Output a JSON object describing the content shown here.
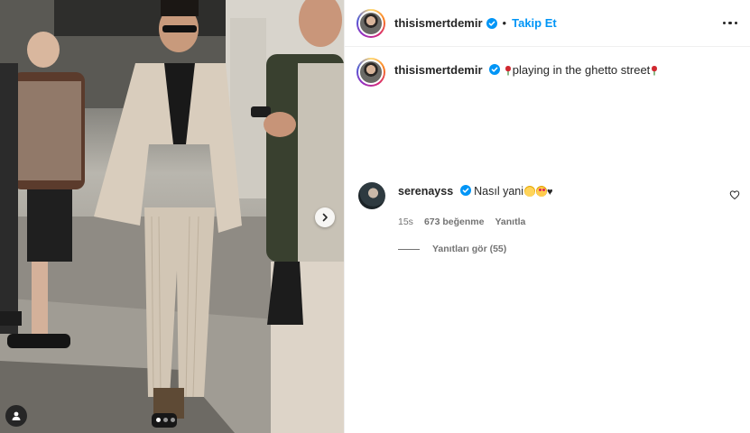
{
  "post": {
    "username": "thisismertdemir",
    "separator": "•",
    "follow_label": "Takip Et",
    "caption_text": "playing in the ghetto street",
    "colors": {
      "accent": "#0095f6",
      "verified": "#0095f6",
      "text": "#262626",
      "muted": "#737373"
    }
  },
  "media": {
    "slides_count": 3,
    "active_slide": 1
  },
  "comment": {
    "username": "serenayss",
    "text": "Nasıl yani",
    "time": "15s",
    "likes": "673 beğenme",
    "reply_label": "Yanıtla",
    "view_replies": "Yanıtları gör (55)"
  },
  "icons": {
    "more": "more-horizontal-icon",
    "verified": "verified-badge-icon",
    "heart": "heart-outline-icon",
    "next": "chevron-right-icon",
    "tag": "user-tag-icon"
  }
}
